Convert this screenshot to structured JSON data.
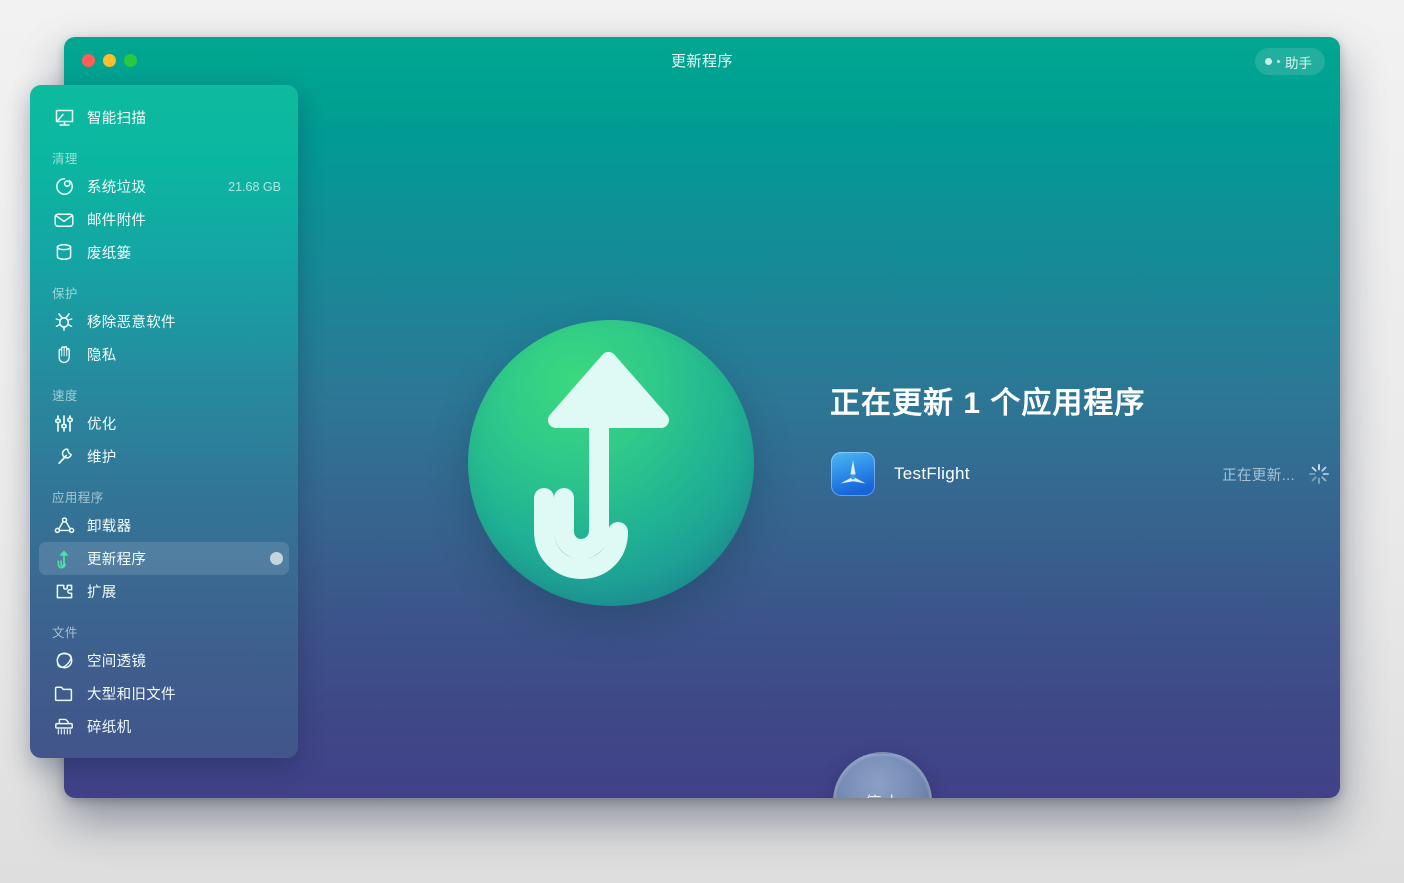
{
  "window": {
    "title": "更新程序",
    "assistant_label": "助手",
    "traffic_lights": [
      "close-button",
      "minimize-button",
      "zoom-button"
    ]
  },
  "sidebar": {
    "top_item": {
      "label": "智能扫描",
      "icon": "monitor-scan-icon"
    },
    "groups": [
      {
        "title": "清理",
        "items": [
          {
            "label": "系统垃圾",
            "icon": "droplet-tag-icon",
            "size": "21.68 GB"
          },
          {
            "label": "邮件附件",
            "icon": "envelope-icon",
            "size": ""
          },
          {
            "label": "废纸篓",
            "icon": "trash-can-icon",
            "size": ""
          }
        ]
      },
      {
        "title": "保护",
        "items": [
          {
            "label": "移除恶意软件",
            "icon": "bug-icon",
            "size": ""
          },
          {
            "label": "隐私",
            "icon": "hand-icon",
            "size": ""
          }
        ]
      },
      {
        "title": "速度",
        "items": [
          {
            "label": "优化",
            "icon": "sliders-icon",
            "size": ""
          },
          {
            "label": "维护",
            "icon": "wrench-icon",
            "size": ""
          }
        ]
      },
      {
        "title": "应用程序",
        "items": [
          {
            "label": "卸载器",
            "icon": "uninstaller-icon",
            "size": ""
          },
          {
            "label": "更新程序",
            "icon": "updater-arrow-icon",
            "size": "",
            "selected": true,
            "badge": true
          },
          {
            "label": "扩展",
            "icon": "puzzle-piece-icon",
            "size": ""
          }
        ]
      },
      {
        "title": "文件",
        "items": [
          {
            "label": "空间透镜",
            "icon": "space-lens-icon",
            "size": ""
          },
          {
            "label": "大型和旧文件",
            "icon": "folder-icon",
            "size": ""
          },
          {
            "label": "碎纸机",
            "icon": "shredder-icon",
            "size": ""
          }
        ]
      }
    ]
  },
  "main": {
    "hero_icon": "updater-hook-arrow-icon",
    "headline": "正在更新 1 个应用程序",
    "apps": [
      {
        "name": "TestFlight",
        "icon": "testflight-icon",
        "status": "正在更新...",
        "spinner": "loading-spinner-icon"
      }
    ],
    "stop_button_label": "停止"
  },
  "colors": {
    "accent_green": "#0dbb9e",
    "window_top": "#00a78f",
    "window_bottom": "#414189",
    "selected_row": "rgba(255,255,255,0.13)",
    "app_icon_blue": "#1d7fe8"
  }
}
